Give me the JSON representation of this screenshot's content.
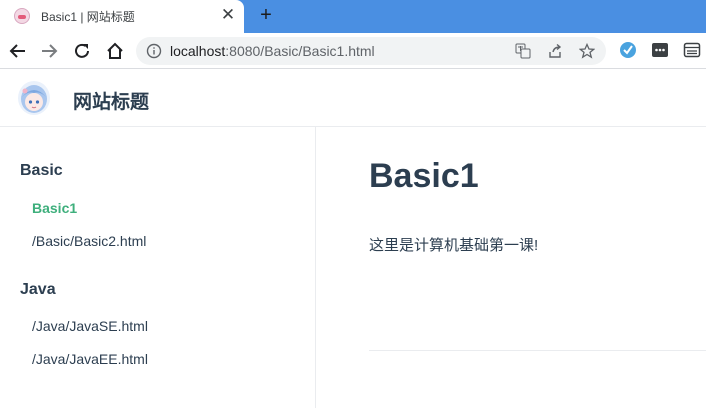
{
  "browser": {
    "tab": {
      "title": "Basic1 | 网站标题",
      "close_glyph": "✕"
    },
    "new_tab_glyph": "+",
    "url": {
      "host": "localhost",
      "rest": ":8080/Basic/Basic1.html"
    }
  },
  "header": {
    "site_title": "网站标题"
  },
  "sidebar": {
    "groups": [
      {
        "title": "Basic",
        "links": [
          "Basic1",
          "/Basic/Basic2.html"
        ]
      },
      {
        "title": "Java",
        "links": [
          "/Java/JavaSE.html",
          "/Java/JavaEE.html"
        ]
      }
    ]
  },
  "content": {
    "h1": "Basic1",
    "paragraph": "这里是计算机基础第一课!"
  },
  "colors": {
    "tabstrip": "#4a8fe2",
    "accent": "#3eaf7c",
    "text": "#2c3e50"
  }
}
